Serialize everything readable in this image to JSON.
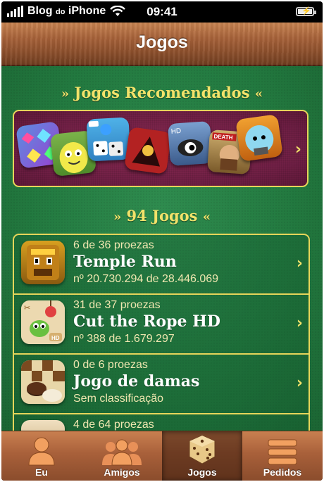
{
  "status_bar": {
    "carrier_main": "Blog ",
    "carrier_small": "do",
    "carrier_end": " iPhone",
    "time": "09:41"
  },
  "navbar": {
    "title": "Jogos"
  },
  "recommended": {
    "title": "Jogos Recomendados",
    "icons": [
      "bejeweled-icon",
      "monster-icon",
      "dice-icon",
      "samurai-icon",
      "eye-monster-icon",
      "warrior-icon",
      "robot-icon"
    ]
  },
  "games": {
    "title": "94 Jogos",
    "items": [
      {
        "achievements": "6 de 36 proezas",
        "name": "Temple Run",
        "rank": "nº 20.730.294 de 28.446.069",
        "icon": "temple-run-icon"
      },
      {
        "achievements": "31 de 37 proezas",
        "name": "Cut the Rope HD",
        "rank": "nº 388 de 1.679.297",
        "icon": "cut-the-rope-icon"
      },
      {
        "achievements": "0 de 6 proezas",
        "name": "Jogo de damas",
        "rank": "Sem classificação",
        "icon": "checkers-icon"
      },
      {
        "achievements": "4 de 64 proezas",
        "name": "",
        "rank": "",
        "icon": "game-icon"
      }
    ]
  },
  "tabs": [
    {
      "label": "Eu",
      "icon": "person-icon"
    },
    {
      "label": "Amigos",
      "icon": "friends-icon"
    },
    {
      "label": "Jogos",
      "icon": "dice-icon",
      "active": true
    },
    {
      "label": "Pedidos",
      "icon": "requests-icon"
    }
  ],
  "colors": {
    "felt": "#237a40",
    "gold": "#f2e26a",
    "wood": "#a8633a",
    "recommended_bg": "#6e1f44"
  }
}
